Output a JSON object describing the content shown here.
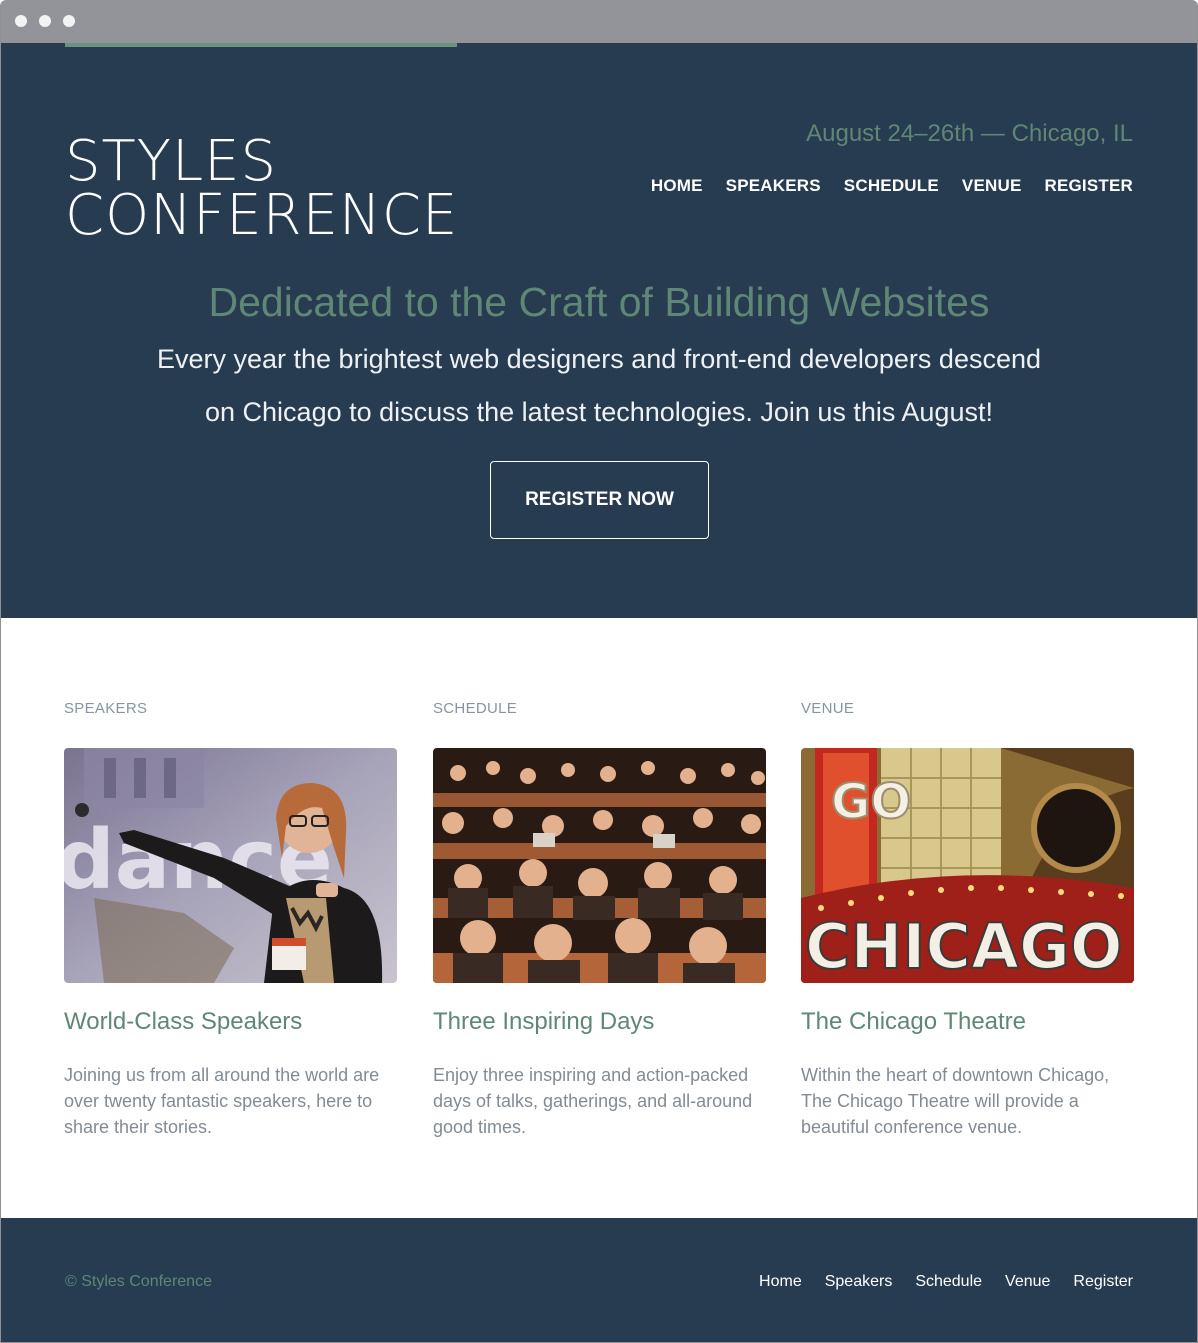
{
  "logo": {
    "line1": "STYLES",
    "line2": "CONFERENCE"
  },
  "header": {
    "tagline": "August 24–26th — Chicago, IL",
    "nav": [
      "HOME",
      "SPEAKERS",
      "SCHEDULE",
      "VENUE",
      "REGISTER"
    ]
  },
  "hero": {
    "title": "Dedicated to the Craft of Building Websites",
    "text": "Every year the brightest web designers and front-end developers descend on Chicago to discuss the latest technologies. Join us this August!",
    "cta": "REGISTER NOW"
  },
  "features": [
    {
      "label": "SPEAKERS",
      "title": "World-Class Speakers",
      "text": "Joining us from all around the world are over twenty fantastic speakers, here to share their stories.",
      "image": "speaker-photo"
    },
    {
      "label": "SCHEDULE",
      "title": "Three Inspiring Days",
      "text": "Enjoy three inspiring and action-packed days of talks, gatherings, and all-around good times.",
      "image": "audience-photo"
    },
    {
      "label": "VENUE",
      "title": "The Chicago Theatre",
      "text": "Within the heart of downtown Chicago, The Chicago Theatre will provide a beautiful conference venue.",
      "image": "chicago-theatre-sign-photo",
      "sign_text": "CHICAGO",
      "sign_vertical": "GO"
    }
  ],
  "footer": {
    "copyright": "© Styles Conference",
    "nav": [
      "Home",
      "Speakers",
      "Schedule",
      "Venue",
      "Register"
    ]
  },
  "colors": {
    "navy": "#273b51",
    "green": "#5f8775",
    "body_text": "#828b94"
  }
}
